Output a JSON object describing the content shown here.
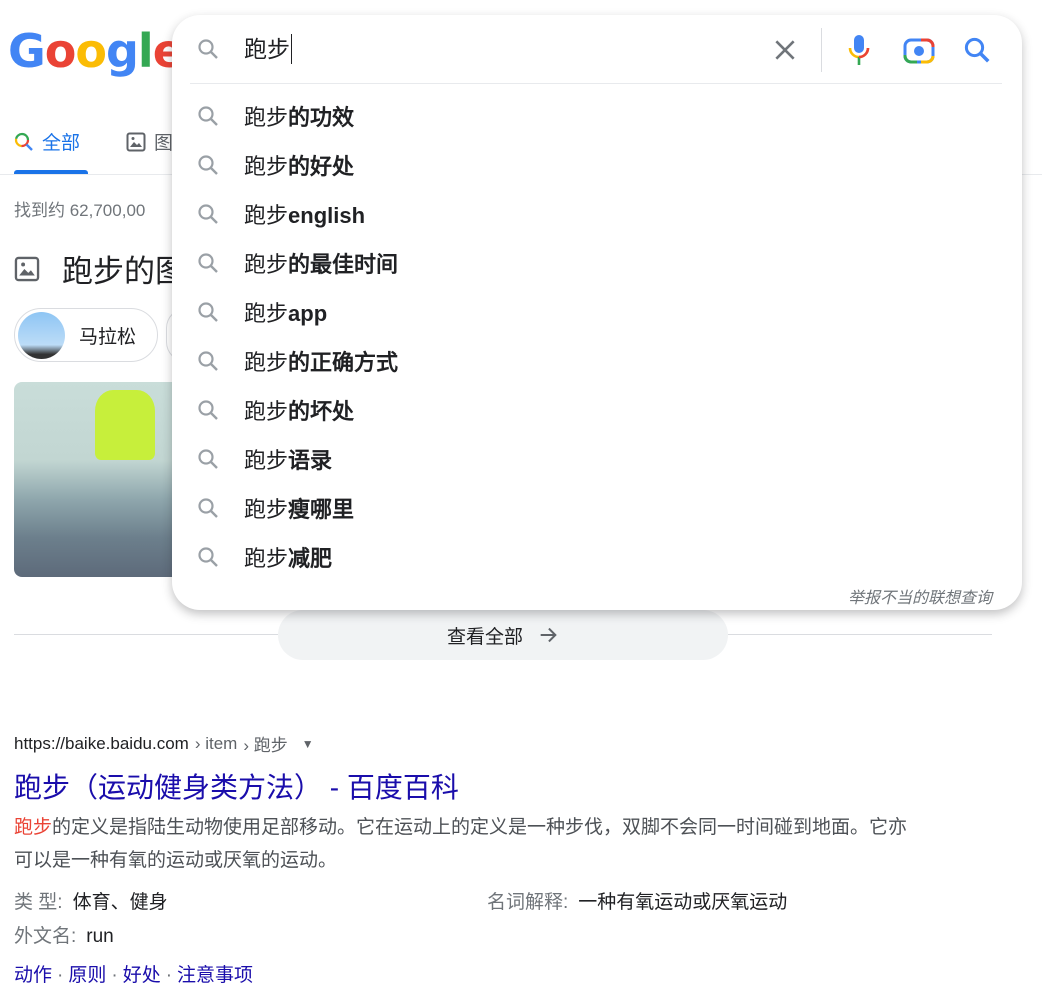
{
  "logo": "Google",
  "tabs": [
    {
      "label": "全部",
      "active": true
    },
    {
      "label": "图"
    }
  ],
  "result_count": "找到约 62,700,00",
  "images_heading": "跑步的图",
  "chips": [
    {
      "label": "马拉松"
    }
  ],
  "see_all": "查看全部",
  "search": {
    "query": "跑步",
    "report": "举报不当的联想查询",
    "suggestions": [
      {
        "prefix": "跑步",
        "suffix": "的功效"
      },
      {
        "prefix": "跑步",
        "suffix": "的好处"
      },
      {
        "prefix": "跑步",
        "suffix": "english"
      },
      {
        "prefix": "跑步",
        "suffix": "的最佳时间"
      },
      {
        "prefix": "跑步",
        "suffix": "app"
      },
      {
        "prefix": "跑步",
        "suffix": "的正确方式"
      },
      {
        "prefix": "跑步",
        "suffix": "的坏处"
      },
      {
        "prefix": "跑步",
        "suffix": "语录"
      },
      {
        "prefix": "跑步",
        "suffix": "瘦哪里"
      },
      {
        "prefix": "跑步",
        "suffix": "减肥"
      }
    ]
  },
  "result": {
    "url_domain": "https://baike.baidu.com",
    "url_path1": "› item",
    "url_path2": "› 跑步",
    "title": "跑步（运动健身类方法） - 百度百科",
    "snippet_highlight": "跑步",
    "snippet": "的定义是指陆生动物使用足部移动。它在运动上的定义是一种步伐，双脚不会同一时间碰到地面。它亦可以是一种有氧的运动或厌氧的运动。",
    "facts": [
      {
        "label": "类 型:",
        "value": "体育、健身"
      },
      {
        "label": "名词解释:",
        "value": "一种有氧运动或厌氧运动"
      },
      {
        "label": "外文名:",
        "value": "run"
      }
    ],
    "links": [
      "动作",
      "原则",
      "好处",
      "注意事项"
    ]
  },
  "colors": {
    "accent": "#1a73e8",
    "link": "#1a0dab",
    "highlight": "#ea4335"
  }
}
